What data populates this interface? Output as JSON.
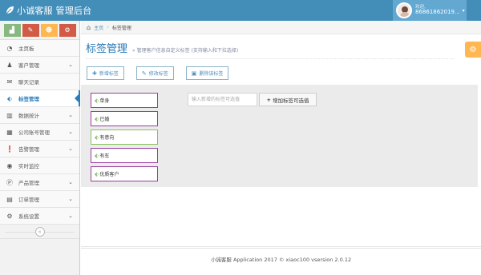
{
  "header": {
    "brand": "小诚客服 管理后台",
    "welcome": "欢迎,",
    "user_id": "86861862019..."
  },
  "shortcuts": [
    {
      "icon": "signal-icon",
      "color": "#87b87f"
    },
    {
      "icon": "pencil-icon",
      "color": "#d15b47"
    },
    {
      "icon": "users-icon",
      "color": "#ffb752"
    },
    {
      "icon": "cogs-icon",
      "color": "#d15b47"
    }
  ],
  "sidebar": {
    "items": [
      {
        "label": "主页板",
        "icon": "dashboard-icon",
        "arrow": false
      },
      {
        "label": "客户管理",
        "icon": "group-icon",
        "arrow": true
      },
      {
        "label": "聊天记录",
        "icon": "comments-icon",
        "arrow": false
      },
      {
        "label": "标签管理",
        "icon": "tag-icon",
        "arrow": false,
        "active": true
      },
      {
        "label": "数据统计",
        "icon": "bar-chart-icon",
        "arrow": true
      },
      {
        "label": "公司账号管理",
        "icon": "building-icon",
        "arrow": true
      },
      {
        "label": "告警管理",
        "icon": "exclamation-icon",
        "arrow": true
      },
      {
        "label": "实时监控",
        "icon": "eye-icon",
        "arrow": false
      },
      {
        "label": "产品管理",
        "icon": "product-icon",
        "arrow": true
      },
      {
        "label": "订单管理",
        "icon": "file-icon",
        "arrow": true
      },
      {
        "label": "系统设置",
        "icon": "gear-icon",
        "arrow": true
      }
    ]
  },
  "breadcrumb": {
    "home": "主页",
    "current": "标签管理"
  },
  "page": {
    "title": "标签管理",
    "subtitle": "管理客户信息自定义标签 (支持输入和下拉选择)"
  },
  "toolbar": {
    "add": "新增标签",
    "edit": "修改标签",
    "delete": "删除该标签"
  },
  "tags": [
    {
      "label": "单身",
      "style": "purple"
    },
    {
      "label": "已婚",
      "style": "purple"
    },
    {
      "label": "有意向",
      "style": "green"
    },
    {
      "label": "有车",
      "style": "purple"
    },
    {
      "label": "优质客户",
      "style": "purple"
    }
  ],
  "tag_input": {
    "placeholder": "输入新增的标签可选值",
    "button": "增加标签可选值"
  },
  "footer": {
    "text": "小诚客服 Application 2017 © xiaoc100 vsersion 2.0.12"
  },
  "colors": {
    "navbar": "#438eb9",
    "accent": "#2679b5",
    "tag_border": "#9c3ca0",
    "tag_border_selected": "#87c15c",
    "settings": "#ffb752"
  }
}
